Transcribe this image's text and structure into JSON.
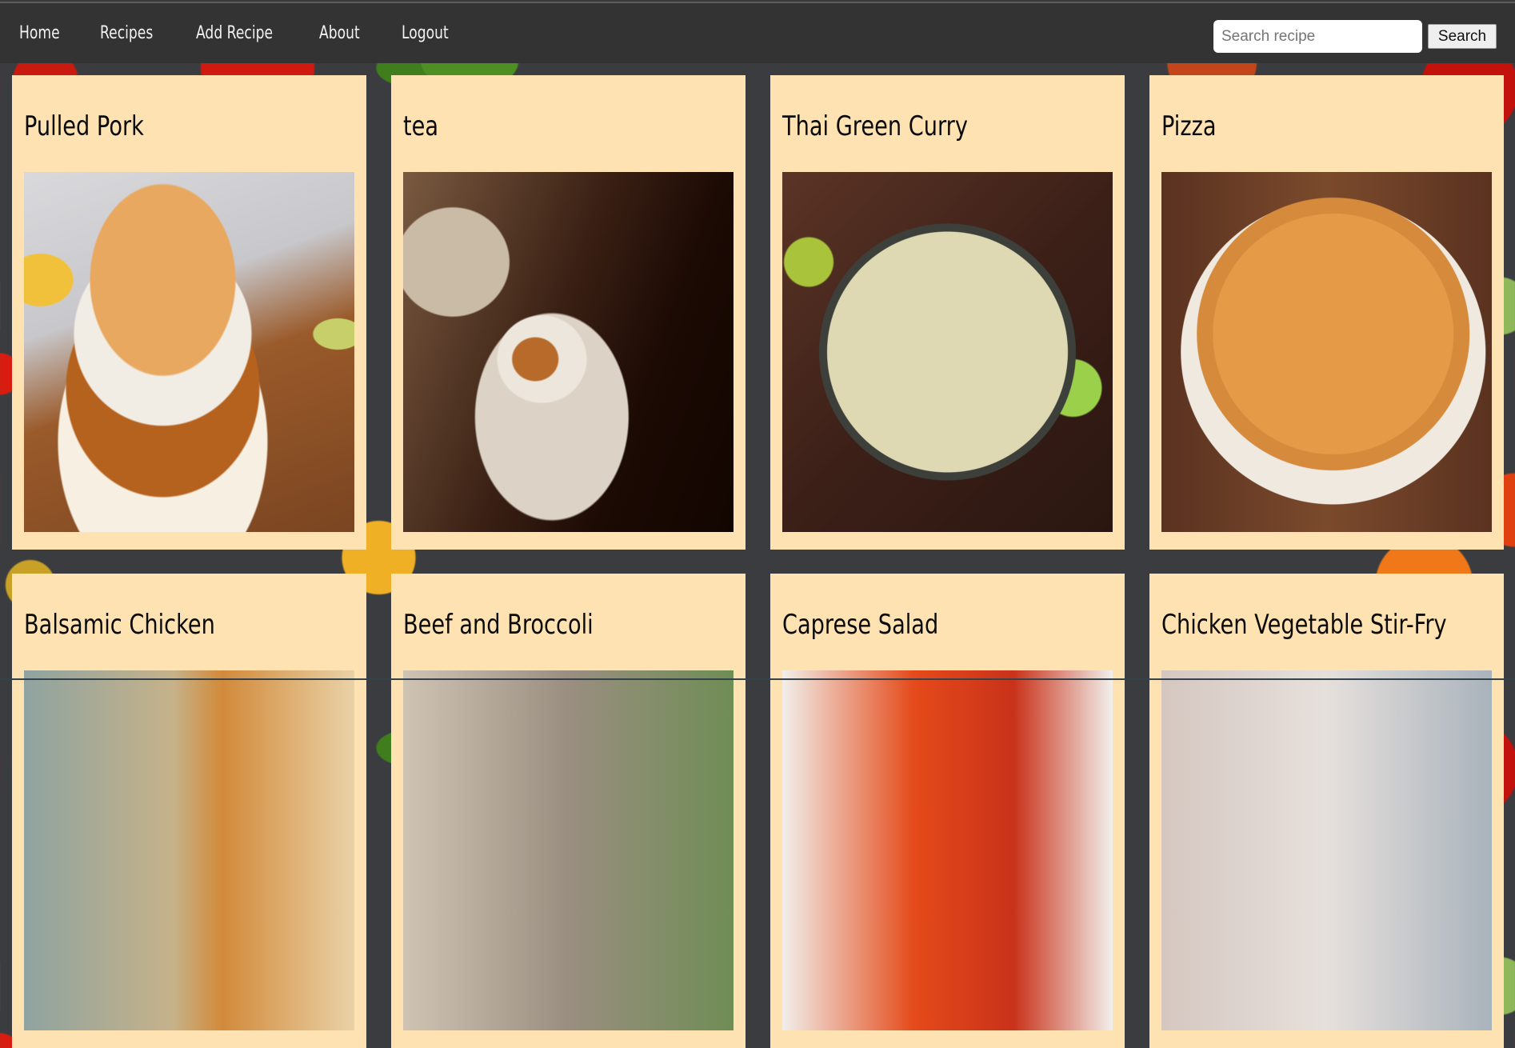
{
  "nav": {
    "links": [
      {
        "label": "Home"
      },
      {
        "label": "Recipes"
      },
      {
        "label": "Add Recipe"
      },
      {
        "label": "About"
      },
      {
        "label": "Logout"
      }
    ],
    "search": {
      "placeholder": "Search recipe",
      "value": "",
      "button_label": "Search"
    }
  },
  "colors": {
    "navbar_bg": "#333333",
    "card_bg": "#ffe2b1",
    "nav_text": "#f2f2f2"
  },
  "recipes": [
    {
      "title": "Pulled Pork",
      "image": "pulled-pork-sandwich-photo"
    },
    {
      "title": "tea",
      "image": "tea-pouring-photo"
    },
    {
      "title": "Thai Green Curry",
      "image": "thai-green-curry-photo"
    },
    {
      "title": "Pizza",
      "image": "pizza-photo"
    },
    {
      "title": "Balsamic Chicken",
      "image": "balsamic-chicken-photo"
    },
    {
      "title": "Beef and Broccoli",
      "image": "beef-and-broccoli-photo"
    },
    {
      "title": "Caprese Salad",
      "image": "caprese-salad-photo"
    },
    {
      "title": "Chicken Vegetable Stir-Fry",
      "image": "chicken-stir-fry-photo"
    }
  ]
}
